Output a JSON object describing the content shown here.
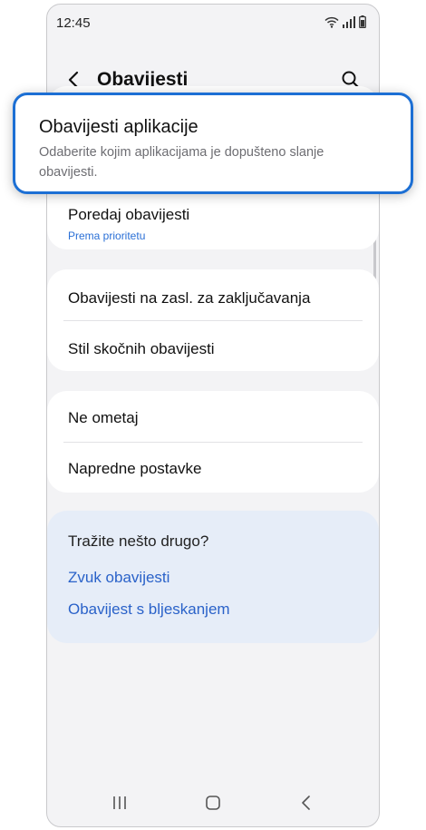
{
  "status_bar": {
    "time": "12:45"
  },
  "header": {
    "title": "Obavijesti"
  },
  "highlighted_item": {
    "title": "Obavijesti aplikacije",
    "description": "Odaberite kojim aplikacijama je dopušteno slanje obavijesti."
  },
  "group1": {
    "sort": {
      "title": "Poredaj obavijesti",
      "value": "Prema prioritetu"
    }
  },
  "group2": {
    "items": [
      "Obavijesti na zasl. za zaključavanja",
      "Stil skočnih obavijesti"
    ]
  },
  "group3": {
    "items": [
      "Ne ometaj",
      "Napredne postavke"
    ]
  },
  "suggestions": {
    "title": "Tražite nešto drugo?",
    "links": [
      "Zvuk obavijesti",
      "Obavijest s bljeskanjem"
    ]
  },
  "colors": {
    "accent": "#1c6fd4",
    "link": "#2a62c9",
    "background": "#f3f3f5"
  },
  "icons": {
    "back": "chevron-left-icon",
    "search": "search-icon",
    "wifi": "wifi-icon",
    "signal": "signal-icon",
    "battery": "battery-icon",
    "nav_recents": "recents-icon",
    "nav_home": "home-icon",
    "nav_back": "nav-back-icon"
  }
}
